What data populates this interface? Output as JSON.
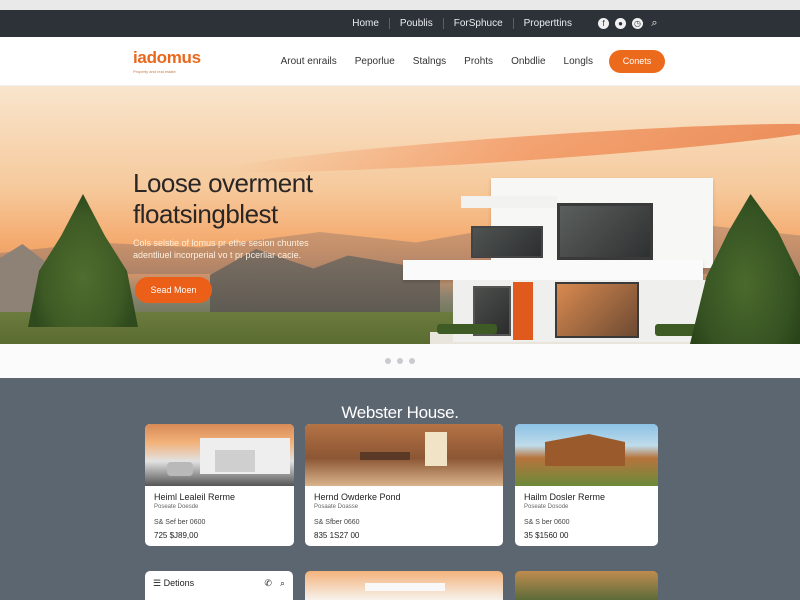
{
  "utility_nav": {
    "links": [
      "Home",
      "Poublis",
      "ForSphuce",
      "Properttins"
    ],
    "icons": [
      "facebook-icon",
      "social-icon",
      "time-icon",
      "search-icon"
    ]
  },
  "brand": {
    "name": "iadomus",
    "tagline": "Property and real estate"
  },
  "main_nav": {
    "links": [
      "Arout enrails",
      "Peporlue",
      "Stalngs",
      "Prohts",
      "Onbdlie",
      "Longls"
    ],
    "cta": "Conets"
  },
  "hero": {
    "title_line1": "Loose overment",
    "title_line2": "floatsingblest",
    "subtitle_line1": "Cols selstie of lomus pr ethe sesion chuntes",
    "subtitle_line2": "adentliuel incorperial vo t pr pcerliar cacie.",
    "button": "Sead Moen",
    "slides": 3,
    "active_slide": 1
  },
  "listing": {
    "title": "Webster House.",
    "cards": [
      {
        "title": "Heiml Lealeil Rerme",
        "subtitle": "Poseate Doesde",
        "line": "S& Sef ber 0600",
        "price": "725 $J89,00"
      },
      {
        "title": "Hernd Owderke Pond",
        "subtitle": "Posaate Doasse",
        "line": "S& Sfber 0660",
        "price": "835 1S27 00"
      },
      {
        "title": "Hailm Dosler Rerme",
        "subtitle": "Poseate Dosode",
        "line": "S& S ber 0600",
        "price": "35 $1560 00"
      }
    ],
    "options_label": "Detions"
  },
  "colors": {
    "accent": "#ec6a1c",
    "utility_bar": "#2d3238",
    "listing_bg": "#5c6670"
  }
}
